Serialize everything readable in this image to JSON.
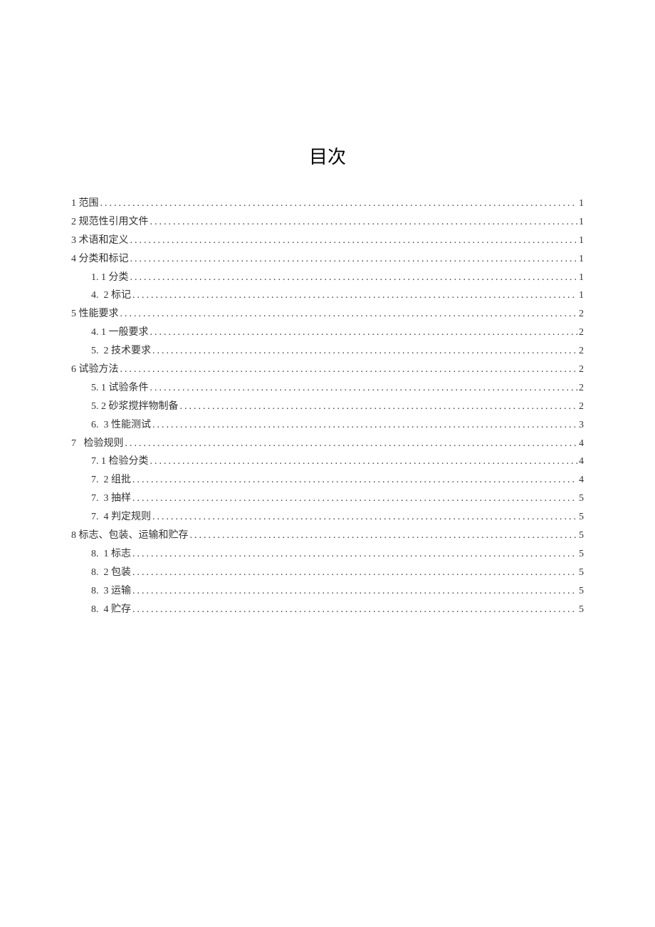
{
  "title": "目次",
  "toc": [
    {
      "level": 1,
      "num": "1",
      "text": "范围",
      "page": "1"
    },
    {
      "level": 1,
      "num": "2",
      "text": "规范性引用文件",
      "page": "1"
    },
    {
      "level": 1,
      "num": "3",
      "text": "术语和定义",
      "page": "1"
    },
    {
      "level": 1,
      "num": "4",
      "text": "分类和标记",
      "page": "1"
    },
    {
      "level": 2,
      "num": "1. 1",
      "text": "分类",
      "page": "1"
    },
    {
      "level": 2,
      "num": "4.  2",
      "text": "标记",
      "page": "1"
    },
    {
      "level": 1,
      "num": "5",
      "text": "性能要求",
      "page": "2"
    },
    {
      "level": 2,
      "num": "4. 1",
      "text": "一般要求",
      "page": "2"
    },
    {
      "level": 2,
      "num": "5.  2",
      "text": "技术要求",
      "page": "2"
    },
    {
      "level": 1,
      "num": "6",
      "text": "试验方法",
      "page": "2"
    },
    {
      "level": 2,
      "num": "5. 1",
      "text": "试验条件",
      "page": "2"
    },
    {
      "level": 2,
      "num": "5. 2",
      "text": "砂浆搅拌物制备",
      "page": "2"
    },
    {
      "level": 2,
      "num": "6.  3",
      "text": "性能测试",
      "page": "3"
    },
    {
      "level": 1,
      "num": "7  ",
      "text": "检验规则",
      "page": "4"
    },
    {
      "level": 2,
      "num": "7. 1",
      "text": "检验分类",
      "page": "4"
    },
    {
      "level": 2,
      "num": "7.  2",
      "text": "组批",
      "page": "4"
    },
    {
      "level": 2,
      "num": "7.  3",
      "text": "抽样",
      "page": "5"
    },
    {
      "level": 2,
      "num": "7.  4",
      "text": "判定规则",
      "page": "5"
    },
    {
      "level": 1,
      "num": "8",
      "text": "标志、包装、运输和贮存",
      "page": "5"
    },
    {
      "level": 2,
      "num": "8.  1",
      "text": "标志",
      "page": "5"
    },
    {
      "level": 2,
      "num": "8.  2",
      "text": "包装",
      "page": "5"
    },
    {
      "level": 2,
      "num": "8.  3",
      "text": "运输",
      "page": "5"
    },
    {
      "level": 2,
      "num": "8.  4",
      "text": "贮存",
      "page": "5"
    }
  ]
}
